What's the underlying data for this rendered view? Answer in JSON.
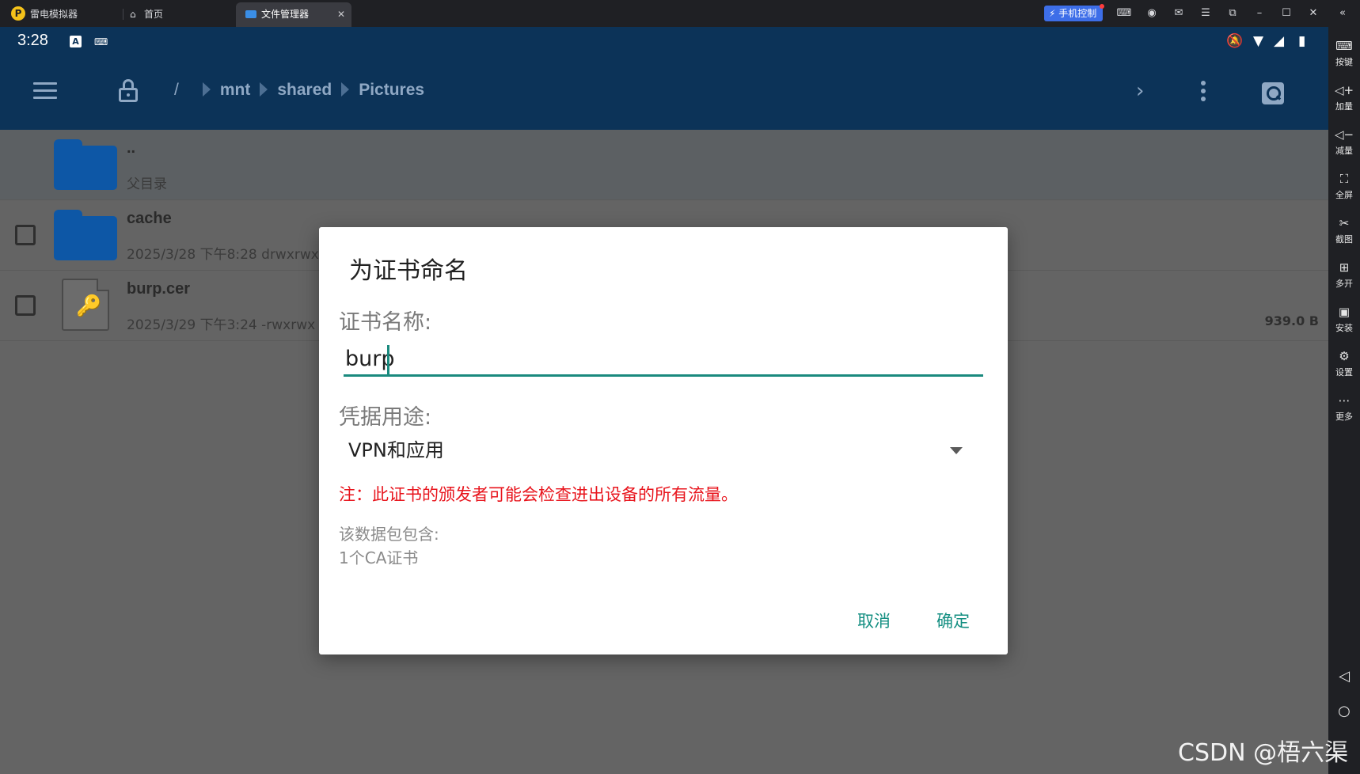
{
  "emulator": {
    "app_name": "雷电模拟器",
    "tabs": [
      {
        "label": "首页"
      },
      {
        "label": "文件管理器"
      }
    ],
    "phone_control_label": "手机控制"
  },
  "statusbar": {
    "time": "3:28",
    "a_glyph": "A"
  },
  "appbar": {
    "breadcrumbs": [
      "/",
      "mnt",
      "shared",
      "Pictures"
    ]
  },
  "files": [
    {
      "name": "..",
      "meta": "父目录",
      "size": ""
    },
    {
      "name": "cache",
      "meta": "2025/3/28 下午8:28   drwxrwx",
      "size": ""
    },
    {
      "name": "burp.cer",
      "meta": "2025/3/29 下午3:24   -rwxrwx",
      "size": "939.0 B"
    }
  ],
  "dialog": {
    "title": "为证书命名",
    "name_label": "证书名称:",
    "name_value": "burp",
    "usage_label": "凭据用途:",
    "usage_value": "VPN和应用",
    "warning": "注：此证书的颁发者可能会检查进出设备的所有流量。",
    "package_label": "该数据包包含:",
    "package_value": "1个CA证书",
    "cancel_label": "取消",
    "ok_label": "确定"
  },
  "sidebar": {
    "items": [
      {
        "label": "按键",
        "icon": "keyboard-icon"
      },
      {
        "label": "加量",
        "icon": "volume-up-icon"
      },
      {
        "label": "减量",
        "icon": "volume-down-icon"
      },
      {
        "label": "全屏",
        "icon": "fullscreen-icon"
      },
      {
        "label": "截图",
        "icon": "scissors-icon"
      },
      {
        "label": "多开",
        "icon": "multi-instance-icon"
      },
      {
        "label": "安装",
        "icon": "apk-install-icon"
      },
      {
        "label": "设置",
        "icon": "settings-icon"
      },
      {
        "label": "更多",
        "icon": "more-icon"
      }
    ]
  },
  "watermark": "CSDN @梧六渠",
  "colors": {
    "appbar": "#0c3358",
    "accent": "#148f82",
    "warning": "#e8141c",
    "folder": "#0d57a6"
  }
}
